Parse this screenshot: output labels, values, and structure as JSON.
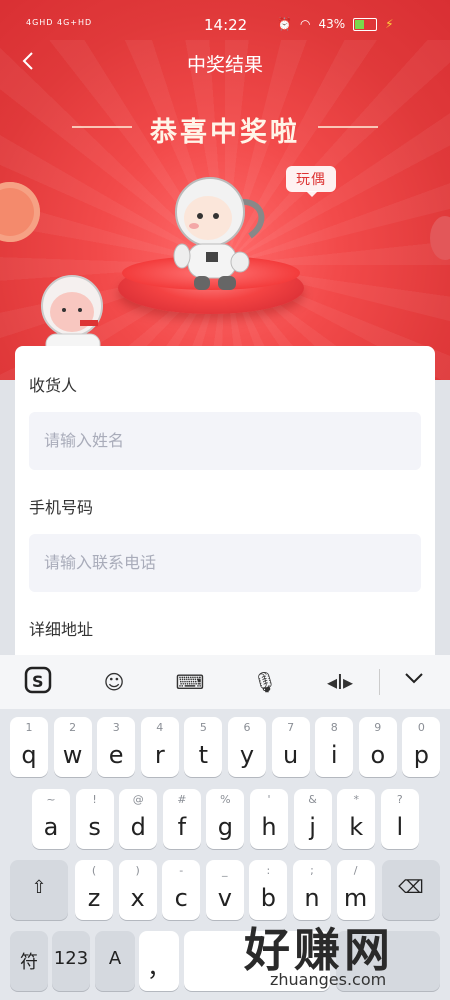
{
  "status": {
    "signal": "4GHD 4G+HD",
    "time": "14:22",
    "battery": "43%"
  },
  "header": {
    "back_icon": "chevron-left-icon",
    "title": "中奖结果"
  },
  "banner": {
    "congrats": "恭喜中奖啦",
    "prize_tag": "玩偶"
  },
  "form": {
    "receiver_label": "收货人",
    "receiver_placeholder": "请输入姓名",
    "phone_label": "手机号码",
    "phone_placeholder": "请输入联系电话",
    "address_label": "详细地址"
  },
  "keyboard": {
    "row1": [
      [
        "1",
        "q"
      ],
      [
        "2",
        "w"
      ],
      [
        "3",
        "e"
      ],
      [
        "4",
        "r"
      ],
      [
        "5",
        "t"
      ],
      [
        "6",
        "y"
      ],
      [
        "7",
        "u"
      ],
      [
        "8",
        "i"
      ],
      [
        "9",
        "o"
      ],
      [
        "0",
        "p"
      ]
    ],
    "row2": [
      [
        "~",
        "a"
      ],
      [
        "!",
        "s"
      ],
      [
        "@",
        "d"
      ],
      [
        "#",
        "f"
      ],
      [
        "%",
        "g"
      ],
      [
        "'",
        "h"
      ],
      [
        "&",
        "j"
      ],
      [
        "*",
        "k"
      ],
      [
        "?",
        "l"
      ]
    ],
    "row3": [
      [
        "(",
        "z"
      ],
      [
        ")",
        "x"
      ],
      [
        "-",
        "c"
      ],
      [
        "_",
        "v"
      ],
      [
        ":",
        "b"
      ],
      [
        ";",
        "n"
      ],
      [
        "/",
        "m"
      ]
    ],
    "fu": "符",
    "num": "123",
    "comma": "，"
  },
  "watermark": {
    "big": "好赚网",
    "small": "zhuanges.com"
  }
}
